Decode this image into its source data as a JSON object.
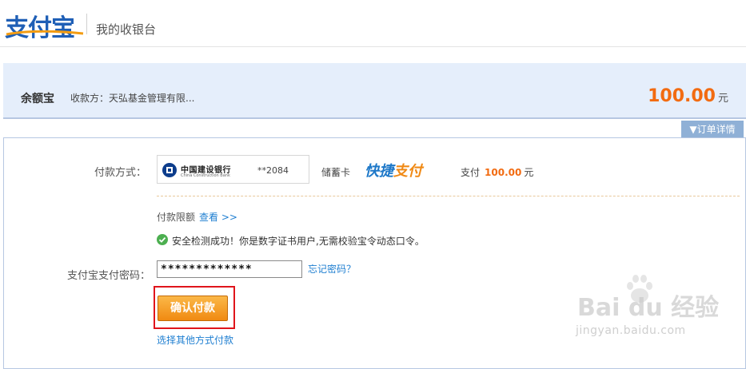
{
  "header": {
    "logo_text": "支付宝",
    "title": "我的收银台"
  },
  "order": {
    "product": "余额宝",
    "payee_label": "收款方：",
    "payee_name": "天弘基金管理有限...",
    "amount": "100.00",
    "currency_unit": "元",
    "details_button": "▼订单详情"
  },
  "payment": {
    "method_label": "付款方式：",
    "bank_name": "中国建设银行",
    "bank_name_en": "China Construction Bank",
    "card_number": "**2084",
    "card_type": "储蓄卡",
    "quickpay_part1": "快捷",
    "quickpay_part2": "支付",
    "pay_prefix": "支付",
    "pay_amount": "100.00",
    "pay_unit": "元",
    "limit_label": "付款限额",
    "limit_link": "查看 >>",
    "security_message": "安全检测成功！你是数字证书用户,无需校验宝令动态口令。",
    "password_label": "支付宝支付密码：",
    "password_value": "*************",
    "forgot_link": "忘记密码？",
    "confirm_button": "确认付款",
    "other_method_link": "选择其他方式付款"
  },
  "watermark": {
    "text": "Bai du 经验",
    "sub": "jingyan.baidu.com"
  },
  "colors": {
    "brand_blue": "#1f5fb6",
    "amount_orange": "#f26b11",
    "link_blue": "#1f7fd1",
    "highlight_red": "#e0141b",
    "button_orange": "#f08a12"
  }
}
